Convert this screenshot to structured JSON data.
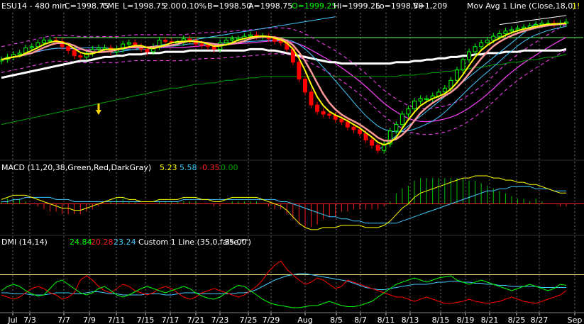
{
  "colors": {
    "background": "#000000",
    "grid": "#6e6e6e",
    "text": "#ffffff",
    "up_candle": "#00ff00",
    "down_candle": "#ff0000",
    "ma_fast": "#ffff00",
    "ma_pink": "#ff9999",
    "ma_cyan": "#40c8ff",
    "ma_magenta": "#ff40ff",
    "ma_white": "#ffffff",
    "ma_green": "#00a000",
    "macd_line": "#ffff00",
    "signal_line": "#40c8ff",
    "hist_pos": "#00c000",
    "hist_neg": "#ff2020",
    "dmi_plus": "#00ff00",
    "dmi_minus": "#ff0000",
    "adx": "#40c8ff",
    "custom_line": "#ffff80",
    "arrow": "#ffd700"
  },
  "header": {
    "symbol": "ESU14 - 480 min",
    "close": "C=1998.75",
    "exchange": "CME",
    "last": "L=1998.75",
    "change": "2.00",
    "pct": "0.10%",
    "bid": "B=1998.50",
    "ask": "A=1998.75",
    "open": "O=1999.25",
    "hi": "Hi=1999.25",
    "lo": "Lo=1998.50",
    "vol": "V=1,209",
    "study": "Mov Avg 1 Line (Close,18,0)",
    "study_val": "1!"
  },
  "macd_header": {
    "name": "MACD (11,20,38,Green,Red,DarkGray)",
    "v1": "5.23",
    "v2": "5.58",
    "v3": "-0.35",
    "v4": "0.00"
  },
  "dmi_header": {
    "name": "DMI (14,14)",
    "plus": "24.84",
    "minus": "20.28",
    "adx": "23.24",
    "custom": "Custom 1 Line (35,0,false,\"\")",
    "custom_val": "35.00"
  },
  "chart_data": {
    "type": "line",
    "instrument": "ESU14 - 480 min",
    "x_labels": [
      "Jul",
      "7/3",
      "7/7",
      "7/9",
      "7/11",
      "7/15",
      "7/17",
      "7/21",
      "7/23",
      "7/25",
      "7/29",
      "Aug",
      "8/5",
      "8/7",
      "8/11",
      "8/13",
      "8/15",
      "8/19",
      "8/21",
      "8/25",
      "8/27",
      "Sep"
    ],
    "panels": {
      "price": {
        "ylim": [
          1893,
          2005
        ],
        "reference_level": 1987,
        "close": [
          1970,
          1972,
          1974,
          1975,
          1979,
          1980,
          1983,
          1985,
          1985,
          1984,
          1980,
          1977,
          1973,
          1972,
          1975,
          1978,
          1979,
          1979,
          1976,
          1978,
          1982,
          1983,
          1980,
          1978,
          1976,
          1980,
          1985,
          1984,
          1983,
          1983,
          1986,
          1985,
          1982,
          1981,
          1980,
          1978,
          1983,
          1985,
          1986,
          1986,
          1988,
          1989,
          1988,
          1988,
          1986,
          1984,
          1983,
          1978,
          1968,
          1955,
          1945,
          1935,
          1930,
          1928,
          1927,
          1924,
          1922,
          1918,
          1916,
          1913,
          1908,
          1904,
          1900,
          1905,
          1915,
          1920,
          1928,
          1932,
          1938,
          1940,
          1940,
          1942,
          1945,
          1948,
          1954,
          1962,
          1970,
          1976,
          1980,
          1983,
          1985,
          1988,
          1990,
          1992,
          1993,
          1994,
          1995,
          1996,
          1997,
          1998,
          1998,
          1997,
          1998,
          1999
        ],
        "sma_slow_white": [
          1956,
          1957,
          1958,
          1959,
          1960,
          1961,
          1962,
          1963,
          1964,
          1965,
          1966,
          1967,
          1968,
          1969,
          1969,
          1970,
          1971,
          1972,
          1972,
          1973,
          1973,
          1974,
          1974,
          1974,
          1975,
          1975,
          1975,
          1976,
          1976,
          1976,
          1976,
          1977,
          1977,
          1977,
          1977,
          1977,
          1977,
          1977,
          1977,
          1977,
          1977,
          1978,
          1978,
          1978,
          1977,
          1977,
          1976,
          1975,
          1974,
          1973,
          1972,
          1971,
          1970,
          1969,
          1968,
          1968,
          1967,
          1967,
          1967,
          1967,
          1967,
          1967,
          1967,
          1967,
          1967,
          1968,
          1968,
          1968,
          1969,
          1969,
          1970,
          1970,
          1971,
          1971,
          1972,
          1972,
          1973,
          1973,
          1974,
          1974,
          1975,
          1975,
          1975,
          1976,
          1976,
          1976,
          1977,
          1977,
          1977,
          1977,
          1977,
          1977,
          1977,
          1978
        ],
        "sma_long_green": [
          1920,
          1921,
          1922,
          1923,
          1924,
          1925,
          1926,
          1927,
          1928,
          1929,
          1930,
          1931,
          1932,
          1933,
          1934,
          1935,
          1936,
          1937,
          1938,
          1939,
          1940,
          1941,
          1942,
          1943,
          1944,
          1945,
          1946,
          1947,
          1948,
          1948,
          1949,
          1950,
          1951,
          1951,
          1952,
          1952,
          1953,
          1954,
          1954,
          1955,
          1955,
          1956,
          1956,
          1957,
          1957,
          1957,
          1957,
          1957,
          1957,
          1957,
          1957,
          1957,
          1957,
          1957,
          1957,
          1957,
          1957,
          1957,
          1957,
          1957,
          1957,
          1957,
          1957,
          1957,
          1957,
          1957,
          1958,
          1958,
          1958,
          1959,
          1959,
          1960,
          1960,
          1961,
          1961,
          1962,
          1962,
          1963,
          1964,
          1964,
          1965,
          1966,
          1966,
          1967,
          1968,
          1968,
          1969,
          1970,
          1970,
          1971,
          1972,
          1972,
          1973,
          1974
        ]
      },
      "macd": {
        "values": [
          "5.23",
          "5.58",
          "-0.35",
          "0.00"
        ],
        "ylim": [
          -14,
          14
        ],
        "macd": [
          2,
          3,
          4,
          4,
          4,
          3,
          2,
          1,
          0,
          -1,
          -2,
          -2,
          -3,
          -3,
          -2,
          -1,
          0,
          1,
          2,
          3,
          3,
          2,
          2,
          1,
          1,
          1,
          2,
          2,
          2,
          2,
          3,
          3,
          3,
          2,
          2,
          1,
          1,
          2,
          3,
          3,
          3,
          3,
          3,
          2,
          1,
          0,
          -1,
          -3,
          -6,
          -9,
          -11,
          -12,
          -12,
          -11,
          -11,
          -11,
          -10,
          -10,
          -10,
          -10,
          -11,
          -11,
          -11,
          -10,
          -8,
          -5,
          -2,
          0,
          3,
          5,
          6,
          7,
          8,
          9,
          10,
          11,
          12,
          12,
          13,
          13,
          13,
          12,
          12,
          11,
          11,
          10,
          10,
          9,
          9,
          8,
          7,
          6,
          5,
          5
        ],
        "signal": [
          1,
          1,
          2,
          2,
          3,
          3,
          3,
          3,
          3,
          2,
          2,
          2,
          1,
          1,
          1,
          1,
          1,
          1,
          1,
          1,
          1,
          1,
          1,
          1,
          1,
          1,
          1,
          1,
          1,
          1,
          2,
          2,
          2,
          2,
          2,
          2,
          2,
          2,
          2,
          2,
          2,
          2,
          2,
          2,
          2,
          2,
          1,
          1,
          0,
          -1,
          -2,
          -3,
          -4,
          -5,
          -6,
          -6,
          -7,
          -7,
          -8,
          -8,
          -9,
          -9,
          -9,
          -9,
          -9,
          -9,
          -8,
          -7,
          -6,
          -5,
          -4,
          -3,
          -2,
          -1,
          0,
          1,
          2,
          3,
          4,
          5,
          6,
          6,
          7,
          7,
          8,
          8,
          8,
          8,
          7,
          7,
          7,
          6,
          6,
          6
        ]
      },
      "dmi": {
        "ylim": [
          0,
          60
        ],
        "custom_line_level": 35,
        "plus_di": [
          20,
          24,
          26,
          24,
          20,
          17,
          15,
          16,
          22,
          28,
          30,
          26,
          22,
          18,
          16,
          18,
          22,
          24,
          20,
          16,
          14,
          16,
          19,
          22,
          24,
          22,
          20,
          18,
          20,
          22,
          24,
          22,
          18,
          15,
          13,
          12,
          14,
          18,
          22,
          25,
          24,
          20,
          16,
          12,
          9,
          7,
          6,
          5,
          4,
          4,
          5,
          6,
          6,
          8,
          10,
          8,
          6,
          5,
          5,
          6,
          8,
          10,
          14,
          18,
          22,
          26,
          28,
          30,
          32,
          30,
          28,
          30,
          32,
          33,
          34,
          30,
          28,
          26,
          28,
          30,
          28,
          26,
          24,
          22,
          20,
          22,
          24,
          26,
          24,
          22,
          20,
          22,
          26,
          25
        ],
        "minus_di": [
          16,
          14,
          12,
          14,
          18,
          22,
          24,
          22,
          18,
          16,
          12,
          14,
          18,
          30,
          34,
          30,
          24,
          20,
          18,
          22,
          26,
          24,
          20,
          18,
          16,
          18,
          22,
          24,
          22,
          18,
          14,
          12,
          14,
          18,
          20,
          22,
          20,
          18,
          16,
          14,
          16,
          20,
          24,
          30,
          38,
          44,
          48,
          40,
          35,
          30,
          26,
          28,
          32,
          30,
          26,
          22,
          24,
          30,
          28,
          26,
          24,
          22,
          20,
          18,
          16,
          14,
          14,
          12,
          10,
          12,
          14,
          12,
          10,
          8,
          8,
          9,
          10,
          12,
          10,
          9,
          8,
          9,
          10,
          12,
          14,
          12,
          10,
          9,
          8,
          10,
          12,
          14,
          16,
          20
        ],
        "adx": [
          18,
          18,
          17,
          17,
          17,
          16,
          16,
          16,
          17,
          18,
          18,
          18,
          17,
          17,
          18,
          19,
          19,
          18,
          17,
          17,
          16,
          16,
          16,
          16,
          17,
          17,
          17,
          16,
          16,
          17,
          18,
          18,
          18,
          17,
          17,
          17,
          17,
          17,
          17,
          18,
          18,
          19,
          21,
          24,
          27,
          30,
          32,
          34,
          35,
          36,
          36,
          35,
          34,
          33,
          32,
          31,
          30,
          29,
          27,
          25,
          23,
          22,
          21,
          21,
          22,
          23,
          24,
          25,
          26,
          26,
          26,
          27,
          28,
          28,
          29,
          29,
          28,
          28,
          27,
          27,
          26,
          26,
          25,
          25,
          24,
          24,
          24,
          24,
          24,
          23,
          23,
          23,
          23,
          23
        ]
      }
    }
  }
}
